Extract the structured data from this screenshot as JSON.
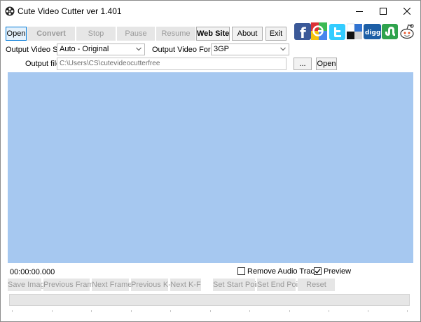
{
  "window": {
    "title": "Cute Video Cutter ver 1.401",
    "icon": "film-reel-icon",
    "controls": [
      "minimize-icon",
      "maximize-icon",
      "close-icon"
    ]
  },
  "toolbar": {
    "open_label": "Open",
    "convert_label": "Convert",
    "stop_label": "Stop",
    "pause_label": "Pause",
    "resume_label": "Resume",
    "website_label": "Web Site",
    "about_label": "About",
    "exit_label": "Exit"
  },
  "social": {
    "icons": [
      "facebook-icon",
      "google-icon",
      "twitter-icon",
      "delicious-icon",
      "digg-icon",
      "stumbleupon-icon",
      "reddit-icon"
    ],
    "digg_text": "digg",
    "colors": {
      "facebook": "#3b5998",
      "google_red": "#db3236",
      "google_green": "#3cba54",
      "google_yellow": "#f4c20d",
      "google_blue": "#4885ed",
      "twitter": "#33ccff",
      "digg": "#1d5fa6",
      "stumbleupon": "#2fa34d"
    }
  },
  "settings": {
    "output_size_label": "Output Video Size:",
    "output_size_value": "Auto - Original",
    "output_format_label": "Output Video Format:",
    "output_format_value": "3GP",
    "output_file_label": "Output file:",
    "output_file_value": "C:\\Users\\CS\\cutevideocutterfree",
    "browse_label": "...",
    "open_label": "Open"
  },
  "preview": {
    "background": "#a6c8f0",
    "time": "00:00:00.000",
    "remove_audio_label": "Remove Audio Track",
    "remove_audio_checked": false,
    "preview_label": "Preview",
    "preview_checked": true
  },
  "controls": {
    "save_image": "Save Image",
    "previous_frame": "Previous Frame",
    "next_frame": "Next Frame",
    "previous_kf": "Previous K-F",
    "next_kf": "Next K-F",
    "set_start": "Set  Start Point",
    "set_end": "Set  End Point",
    "reset": "Reset"
  },
  "progress": {
    "value": 0
  }
}
